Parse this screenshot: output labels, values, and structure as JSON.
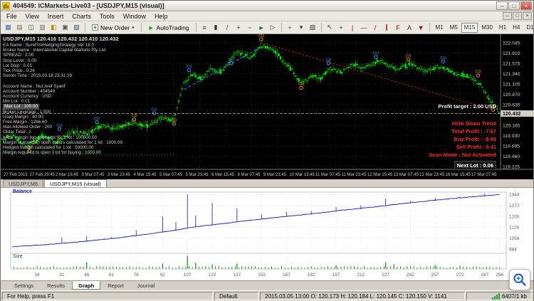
{
  "window": {
    "title": "404549: ICMarkets-Live03 - [USDJPY,M15 (visual)]",
    "menus": [
      "File",
      "View",
      "Insert",
      "Charts",
      "Tools",
      "Window",
      "Help"
    ],
    "controls": {
      "minimize": "–",
      "maximize": "□",
      "close": "×"
    }
  },
  "toolbar": {
    "standard_icons": [
      {
        "name": "new-chart-icon",
        "glyph": "▦",
        "color": "#3a6ea5"
      },
      {
        "name": "profiles-icon",
        "glyph": "▤",
        "color": "#6b6b6b"
      },
      {
        "name": "market-watch-icon",
        "glyph": "◫",
        "color": "#1f7a1f"
      },
      {
        "name": "data-window-icon",
        "glyph": "▥",
        "color": "#6b6b6b"
      },
      {
        "name": "navigator-icon",
        "glyph": "◧",
        "color": "#b8860b"
      },
      {
        "name": "terminal-icon",
        "glyph": "▣",
        "color": "#555555"
      },
      {
        "name": "strategy-tester-icon",
        "glyph": "▧",
        "color": "#2f4f6f"
      }
    ],
    "new_order_label": "New Order",
    "autotrading_label": "AutoTrading",
    "icons": {
      "new_order": "+",
      "autotrading": "►",
      "dropdown": "▾"
    },
    "chart_icons": [
      {
        "name": "bar-chart-icon",
        "glyph": "≡",
        "color": "#333333"
      },
      {
        "name": "candlestick-icon",
        "glyph": "▮",
        "color": "#333333"
      },
      {
        "name": "line-chart-icon",
        "glyph": "/",
        "color": "#333333"
      },
      {
        "name": "zoom-in-icon",
        "glyph": "+",
        "color": "#333333"
      },
      {
        "name": "zoom-out-icon",
        "glyph": "−",
        "color": "#333333"
      },
      {
        "name": "auto-scroll-icon",
        "glyph": "►",
        "color": "#2f6f2f"
      },
      {
        "name": "chart-shift-icon",
        "glyph": "▷",
        "color": "#333333"
      }
    ],
    "tool_icons": [
      {
        "name": "indicators-icon",
        "glyph": "+",
        "color": "#1f7a1f"
      },
      {
        "name": "periods-icon",
        "glyph": "▾",
        "color": "#333333"
      },
      {
        "name": "templates-icon",
        "glyph": "▨",
        "color": "#333333"
      }
    ],
    "draw_icons": [
      {
        "name": "cursor-icon",
        "glyph": "↖",
        "color": "#333333"
      },
      {
        "name": "crosshair-icon",
        "glyph": "+",
        "color": "#333333"
      },
      {
        "name": "vertical-line-icon",
        "glyph": "|",
        "color": "#a00000"
      },
      {
        "name": "horizontal-line-icon",
        "glyph": "―",
        "color": "#a00000"
      },
      {
        "name": "trendline-icon",
        "glyph": "/",
        "color": "#a00000"
      },
      {
        "name": "channel-icon",
        "glyph": "∥",
        "color": "#a00000"
      },
      {
        "name": "fibonacci-icon",
        "glyph": "F",
        "color": "#a00000"
      },
      {
        "name": "text-icon",
        "glyph": "A",
        "color": "#333333"
      },
      {
        "name": "arrows-icon",
        "glyph": "▼",
        "color": "#a00000"
      }
    ],
    "timeframes": [
      "M1",
      "M5",
      "M15",
      "M30",
      "H1",
      "H4",
      "D1",
      "W1",
      "MN"
    ],
    "active_timeframe": "M15"
  },
  "chart": {
    "symbol_line": "USDJPY,M15 120.416 120.432 120.410 120.432",
    "ea_info": [
      "EA Name :  SureFireHedgingStrategy  Ver 18.0",
      "Broker Name :  International Capital Markets Pty Ltd.",
      "SPREAD :  2.00",
      "Stop Level :  0.00",
      "Lot Step :  0.01",
      "Tick Price :  0.24",
      "Server Time :  2015.03.18 23:31:29",
      "",
      "Account Name :  Nur Aref Syarif",
      "Account Number :  404549",
      "Account Currency :  USD",
      "Min Lot :  0.01"
    ],
    "ea_highlight": "Max Lot :  100.00",
    "ea_info2": [
      "Broker Leverage :  1:500",
      "Used Margin :  40.00",
      "Free Margin :  1266.60",
      "Max Allowed Order :  200",
      "Order Total :  2",
      "Initial margin requirements for 1 lot :  100000.00",
      "Margin to maintain open orders calculated for 1 lot :  1000.00",
      "Hedged margin calculated for 1 lot :  50000.00",
      "Margin required to open 1 lot for buying :  1000.00"
    ],
    "profit_target": "Profit target :  2.00 USD",
    "trend_status": [
      "Hi/Hi Down Trend",
      "Total Profit :  -7.67",
      "Buy Profit :  -8.08",
      "Sell Profit :  0.41",
      "Scan Mode :  Not Activated"
    ],
    "next_lot": "Next Lot :  0.06"
  },
  "tabs": {
    "charts": [
      "USDJPY,M5",
      "USDJPY,M15 (visual)"
    ],
    "active": "USDJPY,M15 (visual)"
  },
  "tester": {
    "legend": "Balance",
    "size_label": "Size",
    "tabs": [
      "Settings",
      "Results",
      "Graph",
      "Report",
      "Journal"
    ],
    "active_tab": "Graph"
  },
  "statusbar": {
    "help": "For Help, press F1",
    "profile": "Default",
    "bar_info": "2015.03.05 13:00   O: 120.173   H: 120.184   L: 120.145   C: 120.150   V: 1141",
    "connection": "6407/1 kb"
  },
  "chart_data": [
    {
      "type": "candlestick",
      "symbol": "USDJPY,M15",
      "ohlc_current": {
        "open": 120.416,
        "high": 120.432,
        "low": 120.41,
        "close": 120.432
      },
      "current_price": 120.432,
      "y_range": [
        119.16,
        122.21
      ],
      "price_labels": [
        "122.045",
        "121.810",
        "121.575",
        "121.340",
        "121.105",
        "120.870",
        "120.635",
        "120.400",
        "120.165",
        "119.930",
        "119.695",
        "119.460",
        "119.225"
      ],
      "time_labels": [
        "27 Feb 2015",
        "27 Feb 23:45",
        "2 Mar 15:45",
        "3 Mar 07:45",
        "3 Mar 23:45",
        "4 Mar 15:45",
        "5 Mar 07:45",
        "5 Mar 23:45",
        "6 Mar 15:45",
        "9 Mar 07:45",
        "9 Mar 23:45",
        "10 Mar 15:45",
        "11 Mar 07:45",
        "11 Mar 23:45",
        "12 Mar 15:45",
        "13 Mar 07:45",
        "13 Mar 23:45",
        "16 Mar 15:45",
        "17 Mar 07:45"
      ],
      "price_path": [
        [
          0,
          119.85
        ],
        [
          0.02,
          119.95
        ],
        [
          0.05,
          119.68
        ],
        [
          0.08,
          119.92
        ],
        [
          0.11,
          119.78
        ],
        [
          0.14,
          120.02
        ],
        [
          0.17,
          119.96
        ],
        [
          0.2,
          120.16
        ],
        [
          0.23,
          120.1
        ],
        [
          0.26,
          120.22
        ],
        [
          0.29,
          120.15
        ],
        [
          0.32,
          120.33
        ],
        [
          0.345,
          120.28
        ],
        [
          0.365,
          121.15
        ],
        [
          0.385,
          121.32
        ],
        [
          0.4,
          121.22
        ],
        [
          0.42,
          121.45
        ],
        [
          0.44,
          121.38
        ],
        [
          0.47,
          121.82
        ],
        [
          0.5,
          121.72
        ],
        [
          0.52,
          121.98
        ],
        [
          0.545,
          121.88
        ],
        [
          0.565,
          121.62
        ],
        [
          0.585,
          121.38
        ],
        [
          0.6,
          121.12
        ],
        [
          0.62,
          121.3
        ],
        [
          0.64,
          121.24
        ],
        [
          0.66,
          121.45
        ],
        [
          0.68,
          121.38
        ],
        [
          0.7,
          121.55
        ],
        [
          0.73,
          121.48
        ],
        [
          0.76,
          121.65
        ],
        [
          0.79,
          121.44
        ],
        [
          0.82,
          121.56
        ],
        [
          0.85,
          121.4
        ],
        [
          0.88,
          121.52
        ],
        [
          0.91,
          121.34
        ],
        [
          0.94,
          121.28
        ],
        [
          0.96,
          121.08
        ],
        [
          0.98,
          120.72
        ],
        [
          1,
          120.43
        ]
      ],
      "markers": [
        [
          0.055,
          119.58,
          "CD"
        ],
        [
          0.115,
          120.08,
          "CU"
        ],
        [
          0.19,
          120.24,
          "CU"
        ],
        [
          0.265,
          120.3,
          "CD"
        ],
        [
          0.305,
          120.44,
          "CU"
        ],
        [
          0.345,
          120.2,
          "CD"
        ],
        [
          0.375,
          121.42,
          "CU"
        ],
        [
          0.46,
          121.58,
          "CU"
        ],
        [
          0.52,
          122.12,
          "CD"
        ],
        [
          0.6,
          121.02,
          "CD"
        ],
        [
          0.655,
          121.58,
          "CU"
        ],
        [
          0.75,
          121.72,
          "CU"
        ],
        [
          0.815,
          121.66,
          "CD"
        ],
        [
          0.885,
          121.62,
          "CU"
        ],
        [
          0.955,
          121.3,
          "CD"
        ],
        [
          0.985,
          120.52,
          "CD"
        ]
      ],
      "trend_lines": [
        {
          "color": "#e03030",
          "dash": "2,3",
          "points": [
            [
              0,
              120.55
            ],
            [
              0.075,
              119.7
            ]
          ]
        },
        {
          "color": "#e03030",
          "dash": "2,3",
          "points": [
            [
              0.1,
              119.9
            ],
            [
              0.345,
              120.35
            ]
          ]
        },
        {
          "color": "#e03030",
          "dash": "2,3",
          "points": [
            [
              0.52,
              122.05
            ],
            [
              0.995,
              120.48
            ]
          ]
        },
        {
          "color": "#00c000",
          "dash": "1,3",
          "points": [
            [
              0,
              119.5
            ],
            [
              0.345,
              119.5
            ]
          ]
        },
        {
          "color": "#4090ff",
          "dash": "4,3",
          "points": [
            [
              0.365,
              120.98
            ],
            [
              0.52,
              121.95
            ]
          ]
        }
      ]
    },
    {
      "type": "line",
      "title": "Balance",
      "y_labels": [
        1344,
        1272,
        1200,
        1128,
        1056,
        984
      ],
      "x_labels": [
        16,
        31,
        46,
        61,
        76,
        92,
        107,
        122,
        137,
        152,
        167,
        182,
        197,
        212,
        227,
        242,
        257,
        272,
        287,
        296
      ],
      "x_max": 300,
      "balance": [
        [
          1,
          1000
        ],
        [
          20,
          1012
        ],
        [
          40,
          1030
        ],
        [
          60,
          1052
        ],
        [
          80,
          1078
        ],
        [
          100,
          1110
        ],
        [
          107,
          1124
        ],
        [
          120,
          1142
        ],
        [
          140,
          1168
        ],
        [
          160,
          1192
        ],
        [
          180,
          1214
        ],
        [
          200,
          1240
        ],
        [
          220,
          1262
        ],
        [
          240,
          1288
        ],
        [
          260,
          1310
        ],
        [
          280,
          1330
        ],
        [
          296,
          1344
        ]
      ],
      "equity_spikes": [
        [
          31,
          1062
        ],
        [
          46,
          1070
        ],
        [
          61,
          1062
        ],
        [
          76,
          1108
        ],
        [
          92,
          1198
        ],
        [
          100,
          1162
        ],
        [
          107,
          1344
        ],
        [
          112,
          1206
        ],
        [
          122,
          1288
        ],
        [
          137,
          1252
        ],
        [
          152,
          1212
        ],
        [
          167,
          1230
        ],
        [
          182,
          1236
        ],
        [
          197,
          1262
        ],
        [
          212,
          1272
        ],
        [
          227,
          1316
        ],
        [
          242,
          1302
        ],
        [
          257,
          1322
        ],
        [
          272,
          1332
        ],
        [
          287,
          1352
        ]
      ],
      "size_spikes": [
        [
          46,
          9
        ],
        [
          92,
          7
        ],
        [
          107,
          18
        ],
        [
          112,
          8
        ],
        [
          122,
          6
        ],
        [
          137,
          7
        ],
        [
          197,
          5
        ],
        [
          227,
          9
        ],
        [
          232,
          6
        ],
        [
          257,
          5
        ],
        [
          272,
          4
        ]
      ]
    }
  ]
}
